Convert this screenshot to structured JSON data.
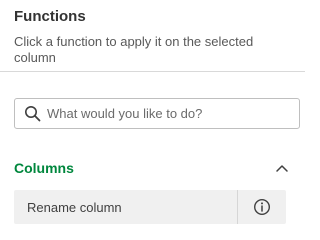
{
  "panel": {
    "title": "Functions",
    "subtitle": "Click a function to apply it on the selected column"
  },
  "search": {
    "placeholder": "What would you like to do?",
    "value": "",
    "icon": "search-icon"
  },
  "sections": [
    {
      "title": "Columns",
      "expanded": true,
      "accent_color": "#00873d",
      "items": [
        {
          "label": "Rename column",
          "icon": "info-icon"
        }
      ]
    }
  ]
}
